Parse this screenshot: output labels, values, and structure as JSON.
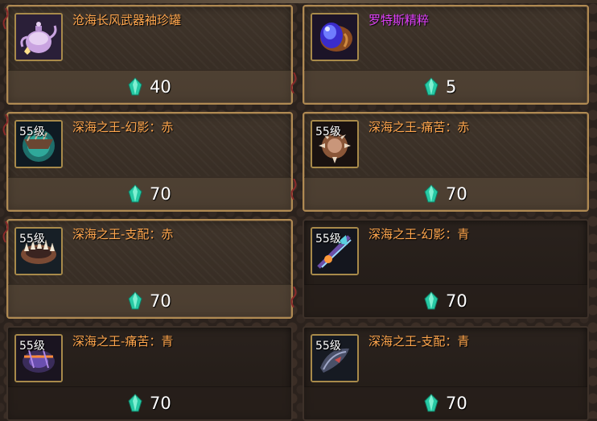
{
  "colors": {
    "name_orange": "#ffa64d",
    "name_purple": "#e040fb",
    "gem": "#27c9a4",
    "gold_border": "#b08a52"
  },
  "shop": {
    "items": [
      {
        "name": "沧海长风武器袖珍罐",
        "price": "40",
        "level": "",
        "icon": "teapot-icon",
        "style": "gold",
        "name_color": "orange"
      },
      {
        "name": "罗特斯精粹",
        "price": "5",
        "level": "",
        "icon": "essence-gem-icon",
        "style": "gold",
        "name_color": "purple"
      },
      {
        "name": "深海之王-幻影：赤",
        "price": "70",
        "level": "55级",
        "icon": "sea-king-phantom-red-icon",
        "style": "gold",
        "name_color": "orange"
      },
      {
        "name": "深海之王-痛苦：赤",
        "price": "70",
        "level": "55级",
        "icon": "sea-king-pain-red-icon",
        "style": "gold",
        "name_color": "orange"
      },
      {
        "name": "深海之王-支配：赤",
        "price": "70",
        "level": "55级",
        "icon": "sea-king-dominate-red-icon",
        "style": "gold",
        "name_color": "orange"
      },
      {
        "name": "深海之王-幻影：青",
        "price": "70",
        "level": "55级",
        "icon": "sea-king-phantom-cyan-icon",
        "style": "dark",
        "name_color": "orange"
      },
      {
        "name": "深海之王-痛苦：青",
        "price": "70",
        "level": "55级",
        "icon": "sea-king-pain-cyan-icon",
        "style": "dark",
        "name_color": "orange"
      },
      {
        "name": "深海之王-支配：青",
        "price": "70",
        "level": "55级",
        "icon": "sea-king-dominate-cyan-icon",
        "style": "dark",
        "name_color": "orange"
      }
    ]
  }
}
